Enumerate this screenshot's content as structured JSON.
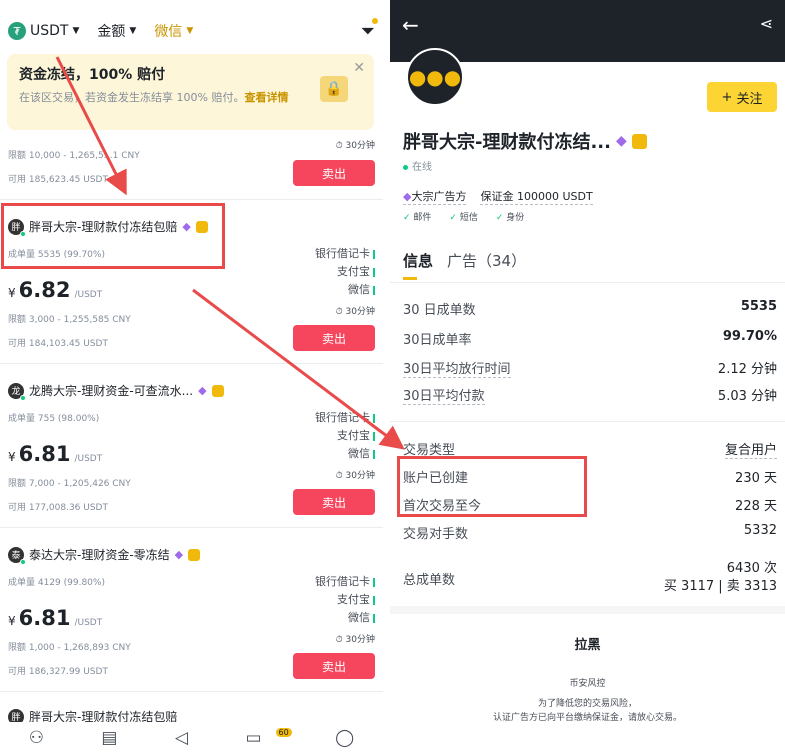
{
  "left": {
    "filters": {
      "coin": "USDT",
      "amount": "金额",
      "payment": "微信"
    },
    "notice": {
      "title": "资金冻结，100% 赔付",
      "text": "在该区交易，若资金发生冻结享 100% 赔付。",
      "link": "查看详情"
    },
    "cards": [
      {
        "limit": "限额 10,000 - 1,265,5…1 CNY",
        "available": "可用 185,623.45 USDT",
        "timer": "30分钟",
        "sell": "卖出"
      },
      {
        "avatar": "胖",
        "name": "胖哥大宗-理财款付冻结包赔",
        "stats": "成单量 5535 (99.70%)",
        "price": "6.82",
        "unit": "/USDT",
        "currency": "¥",
        "limit": "限额 3,000 - 1,255,585 CNY",
        "available": "可用 184,103.45 USDT",
        "timer": "30分钟",
        "sell": "卖出",
        "pays": [
          "银行借记卡",
          "支付宝",
          "微信"
        ]
      },
      {
        "avatar": "龙",
        "name": "龙腾大宗-理财资金-可查流水...",
        "stats": "成单量 755 (98.00%)",
        "price": "6.81",
        "unit": "/USDT",
        "currency": "¥",
        "limit": "限额 7,000 - 1,205,426 CNY",
        "available": "可用 177,008.36 USDT",
        "timer": "30分钟",
        "sell": "卖出",
        "pays": [
          "银行借记卡",
          "支付宝",
          "微信"
        ]
      },
      {
        "avatar": "泰",
        "name": "泰达大宗-理财资金-零冻结",
        "stats": "成单量 4129 (99.80%)",
        "price": "6.81",
        "unit": "/USDT",
        "currency": "¥",
        "limit": "限额 1,000 - 1,268,893 CNY",
        "available": "可用 186,327.99 USDT",
        "timer": "30分钟",
        "sell": "卖出",
        "pays": [
          "银行借记卡",
          "支付宝",
          "微信"
        ]
      },
      {
        "avatar": "胖",
        "name": "胖哥大宗-理财款付冻结包赔"
      }
    ],
    "nav": {
      "badge": "60"
    }
  },
  "right": {
    "follow": "关注",
    "name": "胖哥大宗-理财款付冻结...",
    "status": "在线",
    "tag1": "大宗广告方",
    "tag2": "保证金 100000 USDT",
    "verifs": [
      "邮件",
      "短信",
      "身份"
    ],
    "tab_info": "信息",
    "tab_ads": "广告（34）",
    "stats": [
      {
        "label": "30 日成单数",
        "value": "5535"
      },
      {
        "label": "30日成单率",
        "value": "99.70%"
      },
      {
        "label": "30日平均放行时间",
        "value": "2.12 分钟"
      },
      {
        "label": "30日平均付款",
        "value": "5.03 分钟"
      }
    ],
    "details": [
      {
        "label": "交易类型",
        "value": "复合用户"
      },
      {
        "label": "账户已创建",
        "value": "230 天"
      },
      {
        "label": "首次交易至今",
        "value": "228 天"
      },
      {
        "label": "交易对手数",
        "value": "5332"
      }
    ],
    "total": {
      "label": "总成单数",
      "value": "6430 次",
      "sub": "买 3117 | 卖 3313"
    },
    "block": {
      "title": "拉黑",
      "risk": "币安风控",
      "line1": "为了降低您的交易风险，",
      "line2": "认证广告方已向平台缴纳保证金，请放心交易。"
    }
  },
  "colors": {
    "accent": "#f0b90b",
    "sell": "#f6465d",
    "annotation": "#e94b4b"
  }
}
